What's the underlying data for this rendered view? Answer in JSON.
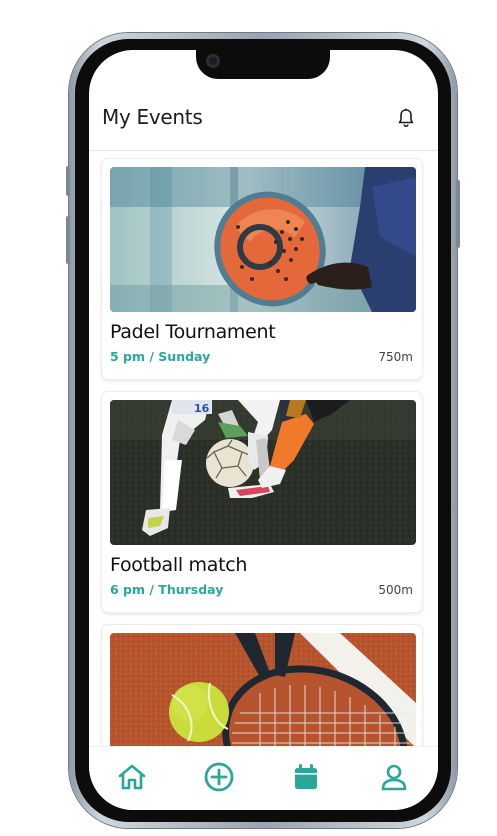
{
  "header": {
    "title": "My Events",
    "notification_icon": "bell-icon"
  },
  "events": [
    {
      "name": "Padel Tournament",
      "time": "5 pm / Sunday",
      "distance": "750m",
      "image": "padel-racket-photo"
    },
    {
      "name": "Football match",
      "time": "6 pm /  Thursday",
      "distance": "500m",
      "image": "football-players-photo"
    },
    {
      "name": "",
      "time": "",
      "distance": "",
      "image": "tennis-ball-racket-photo"
    }
  ],
  "tabbar": {
    "accent": "#2aa79b",
    "tabs": [
      {
        "icon": "home-icon"
      },
      {
        "icon": "add-circle-icon"
      },
      {
        "icon": "calendar-icon"
      },
      {
        "icon": "profile-icon"
      }
    ]
  }
}
